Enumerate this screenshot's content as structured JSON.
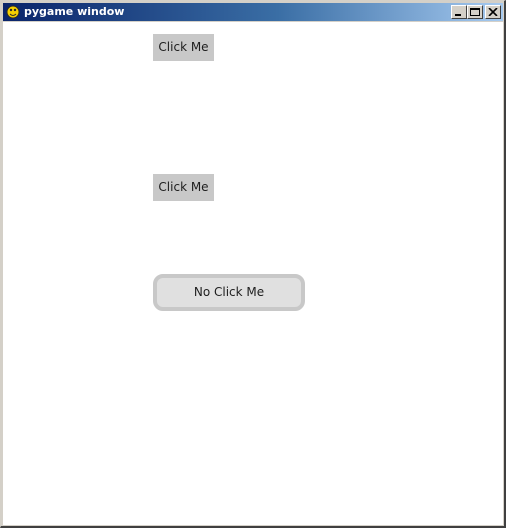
{
  "window": {
    "title": "pygame window",
    "icon": "pygame-snake-icon",
    "controls": {
      "minimize_icon": "minimize-icon",
      "maximize_icon": "maximize-icon",
      "close_icon": "close-icon"
    },
    "titlebar_colors": [
      "#0a246a",
      "#a6caf0"
    ]
  },
  "buttons": [
    {
      "label": "Click Me",
      "fill": "#c8c8c8"
    },
    {
      "label": "Click Me",
      "fill": "#c8c8c8"
    },
    {
      "label": "No Click Me",
      "fill": "#e0e0e0",
      "border": "#c8c8c8"
    }
  ]
}
